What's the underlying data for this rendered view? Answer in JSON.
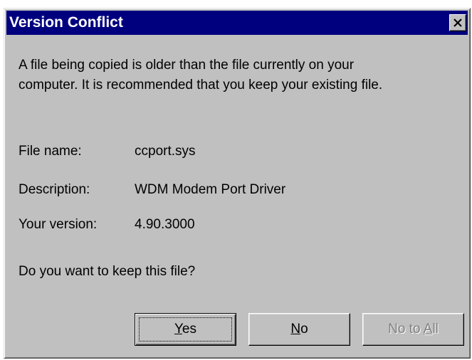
{
  "dialog": {
    "title": "Version Conflict",
    "close_icon": "close-x-icon",
    "message_line1": "A file being copied is older than the file currently on your",
    "message_line2": "computer. It is recommended that you keep your existing file.",
    "fields": [
      {
        "label": "File name:",
        "value": "ccport.sys"
      },
      {
        "label": "Description:",
        "value": "WDM Modem Port Driver"
      },
      {
        "label": "Your version:",
        "value": "4.90.3000"
      }
    ],
    "question": "Do you want to keep this file?",
    "buttons": {
      "yes": {
        "label_mnemonic": "Y",
        "label_rest": "es",
        "default": true,
        "enabled": true
      },
      "no": {
        "label_mnemonic": "N",
        "label_rest": "o",
        "enabled": true
      },
      "no_to_all": {
        "label_prefix": "No to ",
        "label_mnemonic": "A",
        "label_rest": "ll",
        "enabled": false
      }
    }
  },
  "colors": {
    "titlebar": "#00007f",
    "face": "#c0c0c0",
    "disabled_text": "#808080"
  }
}
